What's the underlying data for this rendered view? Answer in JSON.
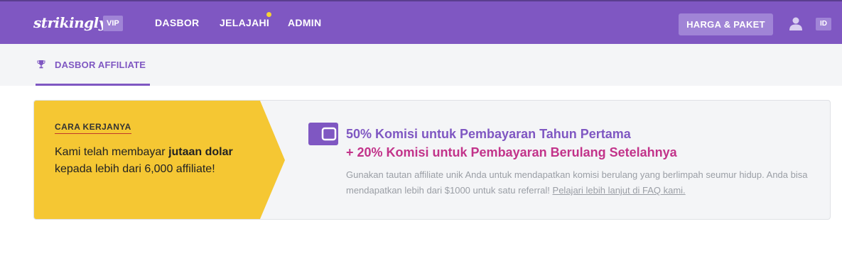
{
  "header": {
    "logo": "strikingly",
    "vip_badge": "VIP",
    "nav": [
      {
        "label": "DASBOR"
      },
      {
        "label": "JELAJAHI",
        "has_notification_dot": true
      },
      {
        "label": "ADMIN"
      }
    ],
    "pricing_button": "HARGA & PAKET",
    "user_icon": "user-icon",
    "language": "ID"
  },
  "tabs": [
    {
      "label": "DASBOR AFFILIATE",
      "icon": "trophy-icon",
      "active": true
    }
  ],
  "how_it_works": {
    "title": "CARA KERJANYA",
    "text_before": "Kami telah membayar ",
    "text_bold": "jutaan dolar",
    "text_after": " kepada lebih dari 6,000 affiliate!"
  },
  "commission": {
    "icon": "wallet-icon",
    "headline_primary": "50% Komisi untuk Pembayaran Tahun Pertama",
    "headline_secondary": "+ 20% Komisi untuk Pembayaran Berulang Setelahnya",
    "description": "Gunakan tautan affiliate unik Anda untuk mendapatkan komisi berulang yang berlimpah seumur hidup. Anda bisa mendapatkan lebih dari $1000 untuk satu referral! ",
    "faq_link": "Pelajari lebih lanjut di FAQ kami."
  },
  "colors": {
    "brand_purple": "#7f57c2",
    "accent_yellow": "#f5c733",
    "accent_magenta": "#c2338a"
  }
}
